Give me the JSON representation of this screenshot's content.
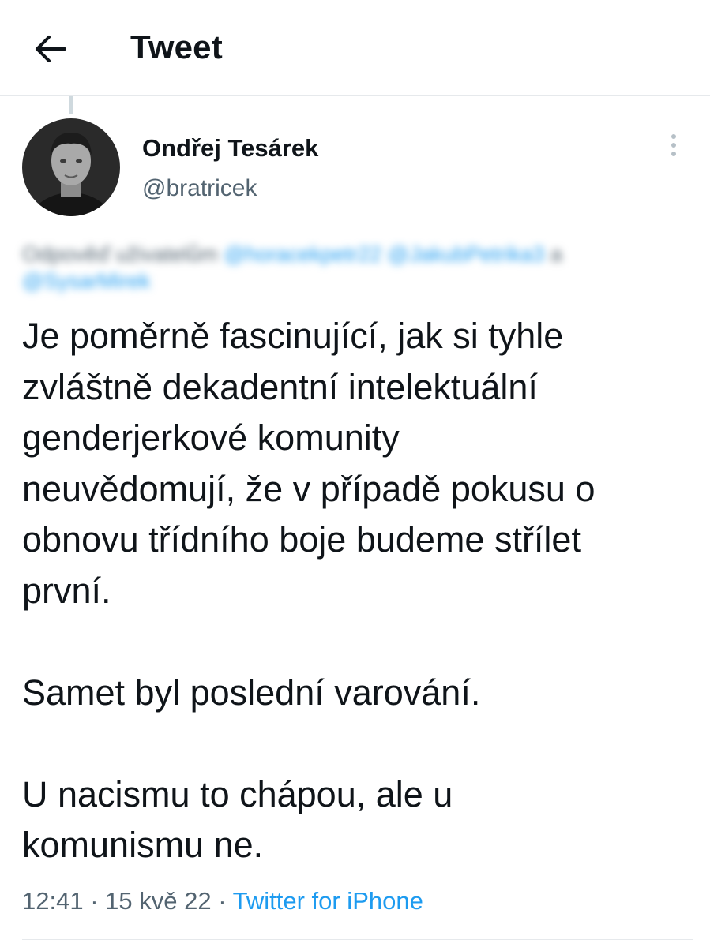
{
  "header": {
    "title": "Tweet",
    "back_icon": "arrow-left-icon"
  },
  "tweet": {
    "author": {
      "display_name": "Ondřej Tesárek",
      "handle": "@bratricek"
    },
    "reply_context": {
      "prefix": "Odpověď uživatelům",
      "mentions": [
        "@horacekpetr22",
        "@JakubPetrika3"
      ],
      "joiner": "a",
      "last_mention": "@SysarMirek"
    },
    "text": "Je poměrně fascinující, jak si tyhle\nzvláštně dekadentní intelektuální\ngenderjerkové komunity\nneuvědomují, že v případě pokusu o\nobnovu třídního boje budeme střílet\nprvní.\n\nSamet byl poslední varování.\n\nU nacismu to chápou, ale u\nkomunismu ne.",
    "time": "12:41",
    "date": "15 kvě 22",
    "separator": "·",
    "source": "Twitter for iPhone"
  },
  "colors": {
    "accent": "#1d9bf0",
    "text_primary": "#0f1419",
    "text_secondary": "#536471",
    "divider": "#e6e9ec"
  }
}
